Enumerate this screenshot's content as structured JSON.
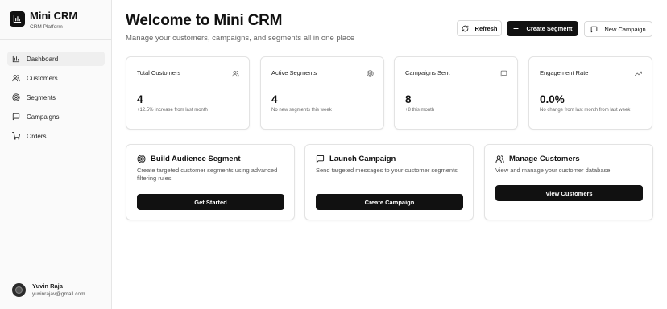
{
  "brand": {
    "title": "Mini CRM",
    "subtitle": "CRM Platform",
    "icon": "bar-chart-icon"
  },
  "sidebar": {
    "items": [
      {
        "label": "Dashboard",
        "icon": "bar-chart-icon",
        "active": true
      },
      {
        "label": "Customers",
        "icon": "users-icon",
        "active": false
      },
      {
        "label": "Segments",
        "icon": "target-icon",
        "active": false
      },
      {
        "label": "Campaigns",
        "icon": "message-square-icon",
        "active": false
      },
      {
        "label": "Orders",
        "icon": "shopping-cart-icon",
        "active": false
      }
    ]
  },
  "user": {
    "name": "Yuvin Raja",
    "email": "yuvinrajav@gmail.com"
  },
  "header": {
    "title": "Welcome to Mini CRM",
    "subtitle": "Manage your customers, campaigns, and segments all in one place",
    "buttons": {
      "refresh": "Refresh",
      "create_segment": "Create Segment",
      "new_campaign": "New Campaign"
    }
  },
  "stats": [
    {
      "label": "Total Customers",
      "value": "4",
      "note": "+12.5% increase from last month",
      "icon": "users-icon"
    },
    {
      "label": "Active Segments",
      "value": "4",
      "note": "No new segments this week",
      "icon": "target-icon"
    },
    {
      "label": "Campaigns Sent",
      "value": "8",
      "note": "+8 this month",
      "icon": "message-square-icon"
    },
    {
      "label": "Engagement Rate",
      "value": "0.0%",
      "note": "No change from last month from last week",
      "icon": "trending-up-icon"
    }
  ],
  "actions": [
    {
      "title": "Build Audience Segment",
      "description": "Create targeted customer segments using advanced filtering rules",
      "button": "Get Started",
      "icon": "target-icon"
    },
    {
      "title": "Launch Campaign",
      "description": "Send targeted messages to your customer segments",
      "button": "Create Campaign",
      "icon": "message-square-icon"
    },
    {
      "title": "Manage Customers",
      "description": "View and manage your customer database",
      "button": "View Customers",
      "icon": "users-icon"
    }
  ],
  "colors": {
    "primary": "#111111",
    "sidebar_bg": "#fafafa",
    "border": "#e3e3e3",
    "muted_text": "#666666"
  }
}
